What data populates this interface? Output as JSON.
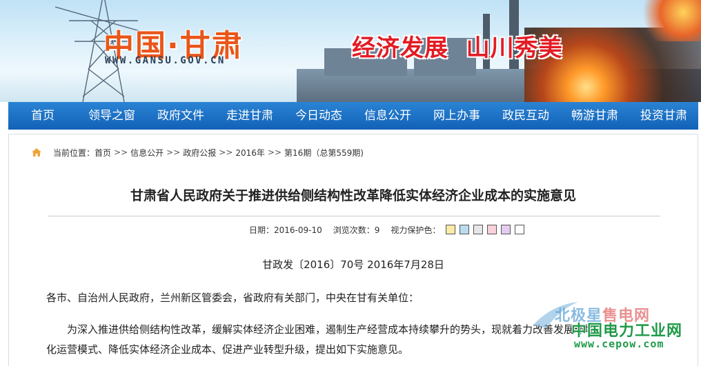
{
  "banner": {
    "logo": "中国·甘肃",
    "url": "WWW.GANSU.GOV.CN",
    "slogan": "经济发展  山川秀美"
  },
  "nav": {
    "items": [
      "首页",
      "领导之窗",
      "政府文件",
      "走进甘肃",
      "今日动态",
      "信息公开",
      "网上办事",
      "政民互动",
      "畅游甘肃",
      "投资甘肃"
    ]
  },
  "breadcrumb": {
    "prefix": "当前位置：",
    "items": [
      "首页",
      "信息公开",
      "政府公报",
      "2016年",
      "第16期（总第559期)"
    ],
    "separator": ">>"
  },
  "article": {
    "title": "甘肃省人民政府关于推进供给侧结构性改革降低实体经济企业成本的实施意见",
    "date_label": "日期：2016-09-10",
    "views_label": "浏览次数：9",
    "eye_care_label": "视力保护色：",
    "eye_care_colors": [
      "#fbe9a6",
      "#b9dcef",
      "#e6e6e6",
      "#f7d2d9",
      "#e4ccef",
      "#ffffff"
    ],
    "doc_number": "甘政发〔2016〕70号   2016年7月28日",
    "addressee": "各市、自治州人民政府，兰州新区管委会，省政府有关部门，中央在甘有关单位：",
    "para_line1": "为深入推进供给侧结构性改革，缓解实体经济企业困难，遏制生产经营成本持续攀升的势头，现就着力改善发展环境、优",
    "para_line2": "化运营模式、降低实体经济企业成本、促进产业转型升级，提出如下实施意见。"
  },
  "watermark": {
    "top_a": "北极星",
    "top_b": "售电网",
    "middle": "中国电力工业网",
    "url": "www.cepow.com"
  }
}
